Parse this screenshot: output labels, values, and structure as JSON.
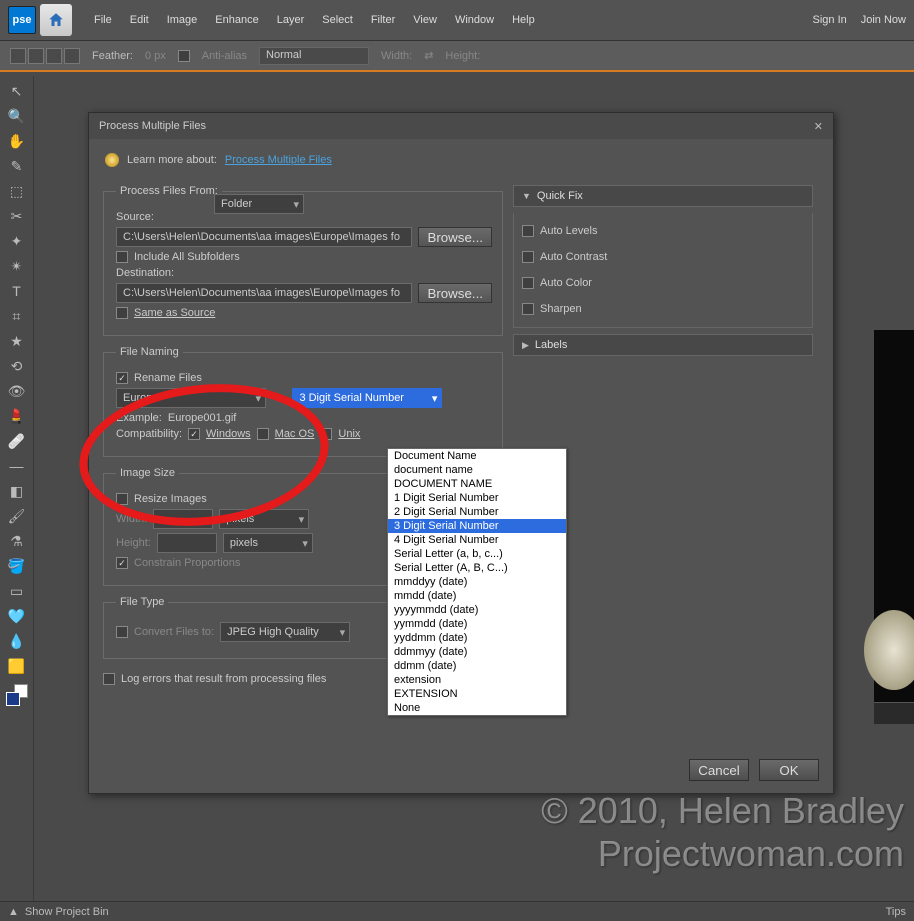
{
  "menubar": {
    "logo": "pse",
    "items": [
      "File",
      "Edit",
      "Image",
      "Enhance",
      "Layer",
      "Select",
      "Filter",
      "View",
      "Window",
      "Help"
    ],
    "right": [
      "Sign In",
      "Join Now"
    ]
  },
  "optionsbar": {
    "feather_label": "Feather:",
    "feather_value": "0 px",
    "antialias": "Anti-alias",
    "mode": "Normal",
    "width_label": "Width:",
    "height_label": "Height:"
  },
  "tools": [
    "↖",
    "+",
    "🔍",
    "✋",
    "👁",
    "✎",
    "⬚",
    "✂",
    "✦",
    "✴",
    "〰",
    "T",
    "⌗",
    "★",
    "⟲",
    "👁",
    "💄",
    "🩹",
    "—",
    "◧",
    "🖌",
    "⚗",
    "🪣",
    "▭",
    "🩵",
    "💧",
    "🟨"
  ],
  "dialog": {
    "title": "Process Multiple Files",
    "learn_label": "Learn more about:",
    "learn_link": "Process Multiple Files",
    "process_from": {
      "legend": "Process Files From:",
      "select": "Folder",
      "source_label": "Source:",
      "source_path": "C:\\Users\\Helen\\Documents\\aa images\\Europe\\Images fo",
      "browse": "Browse...",
      "include_label": "Include All Subfolders",
      "dest_label": "Destination:",
      "dest_path": "C:\\Users\\Helen\\Documents\\aa images\\Europe\\Images fo",
      "same_as": "Same as Source"
    },
    "file_naming": {
      "legend": "File Naming",
      "rename": "Rename Files",
      "first": "Europe",
      "second": "3 Digit Serial Number",
      "example_label": "Example:",
      "example_value": "Europe001.gif",
      "compat_label": "Compatibility:",
      "windows": "Windows",
      "mac": "Mac OS",
      "unix": "Unix"
    },
    "image_size": {
      "legend": "Image Size",
      "resize": "Resize Images",
      "width_label": "Width:",
      "height_label": "Height:",
      "unit": "pixels",
      "constrain": "Constrain Proportions"
    },
    "file_type": {
      "legend": "File Type",
      "convert": "Convert Files to:",
      "format": "JPEG High Quality"
    },
    "log_errors": "Log errors that result from processing files",
    "quickfix": {
      "title": "Quick Fix",
      "items": [
        "Auto Levels",
        "Auto Contrast",
        "Auto Color",
        "Sharpen"
      ]
    },
    "labels": {
      "title": "Labels"
    },
    "buttons": {
      "cancel": "Cancel",
      "ok": "OK"
    }
  },
  "dropdown_options": [
    "Document Name",
    "document name",
    "DOCUMENT NAME",
    "1 Digit Serial Number",
    "2 Digit Serial Number",
    "3 Digit Serial Number",
    "4 Digit Serial Number",
    "Serial Letter (a, b, c...)",
    "Serial Letter (A, B, C...)",
    "mmddyy (date)",
    "mmdd (date)",
    "yyyymmdd (date)",
    "yymmdd (date)",
    "yyddmm (date)",
    "ddmmyy (date)",
    "ddmm (date)",
    "extension",
    "EXTENSION",
    "None"
  ],
  "dropdown_selected_index": 5,
  "watermark": {
    "line1": "© 2010, Helen Bradley",
    "line2": "Projectwoman.com"
  },
  "statusbar": {
    "left": "Show Project Bin",
    "right": "Tips"
  }
}
